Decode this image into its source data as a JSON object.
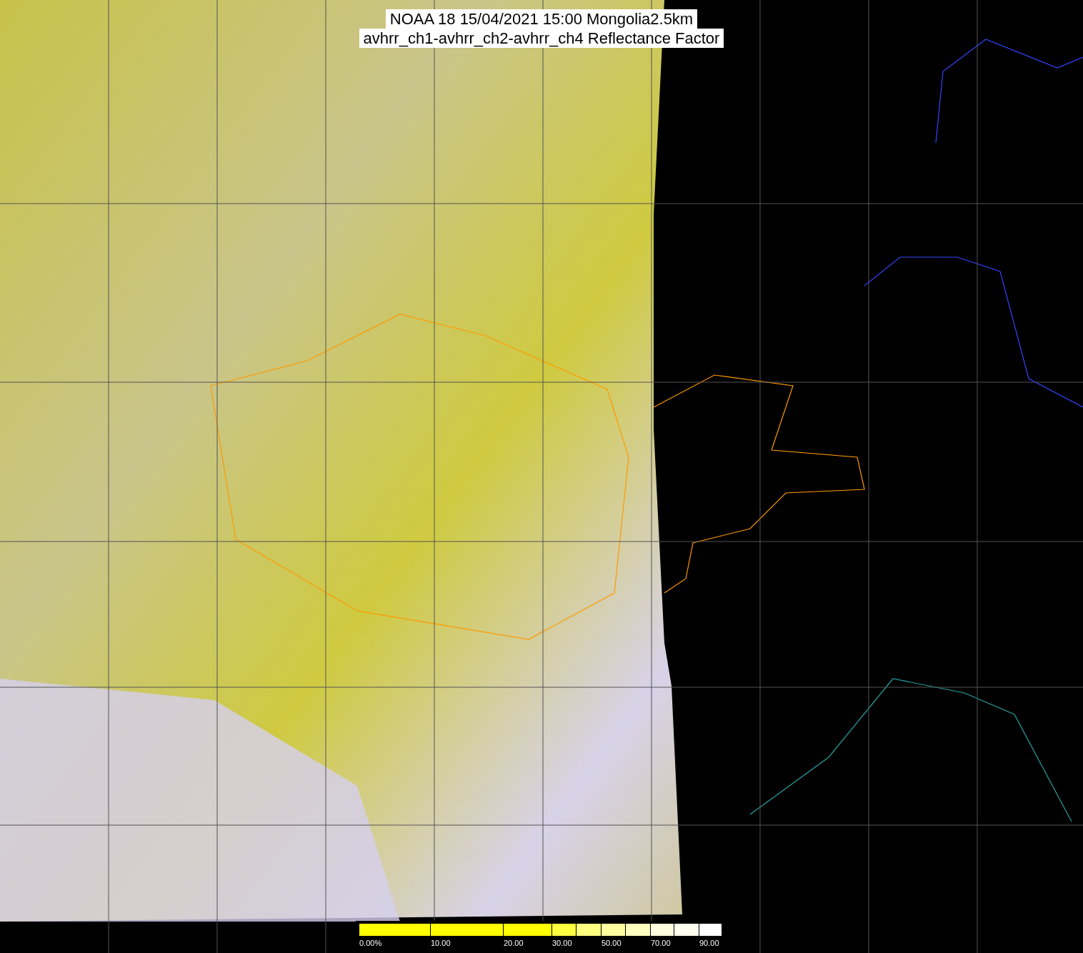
{
  "title": {
    "lines": [
      "NOAA 18 15/04/2021 15:00 Mongolia2.5km",
      "avhrr_ch1-avhrr_ch2-avhrr_ch4 Reflectance Factor"
    ]
  },
  "legend": {
    "segments": [
      {
        "color": "#ffff00",
        "label": "0.00%"
      },
      {
        "color": "#ffff00",
        "label": "10.00"
      },
      {
        "color": "#ffff00",
        "label": "20.00"
      },
      {
        "color": "#ffff40",
        "label": "30.00"
      },
      {
        "color": "#ffff80"
      },
      {
        "color": "#ffffa0",
        "label": "50.00"
      },
      {
        "color": "#ffffc0"
      },
      {
        "color": "#ffffe0",
        "label": "70.00"
      },
      {
        "color": "#fffff0"
      },
      {
        "color": "#ffffff",
        "label": "90.00"
      }
    ]
  }
}
